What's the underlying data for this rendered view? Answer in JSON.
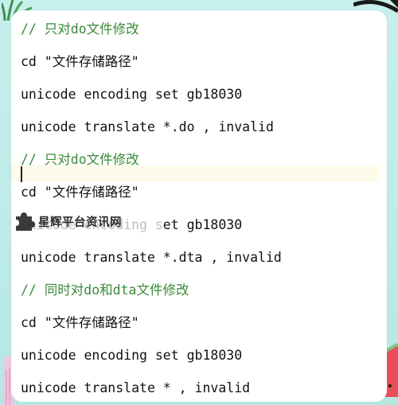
{
  "code_lines": [
    "// 只对do文件修改",
    "cd \"文件存储路径\"",
    "unicode encoding set gb18030",
    "unicode translate *.do , invalid",
    "// 只对do文件修改",
    "cd \"文件存储路径\"",
    "unicode encoding set gb18030",
    "unicode translate *.dta , invalid",
    "// 同时对do和dta文件修改",
    "cd \"文件存储路径\"",
    "unicode encoding set gb18030",
    "unicode translate * , invalid"
  ],
  "watermark": {
    "text": "星辉平台资讯网",
    "icon": "puzzle-piece-icon"
  },
  "colors": {
    "comment": "#3a8a3a",
    "code": "#111111",
    "current_line_bg": "#fdfbe9",
    "frame_bg": "#b9e9e6"
  }
}
